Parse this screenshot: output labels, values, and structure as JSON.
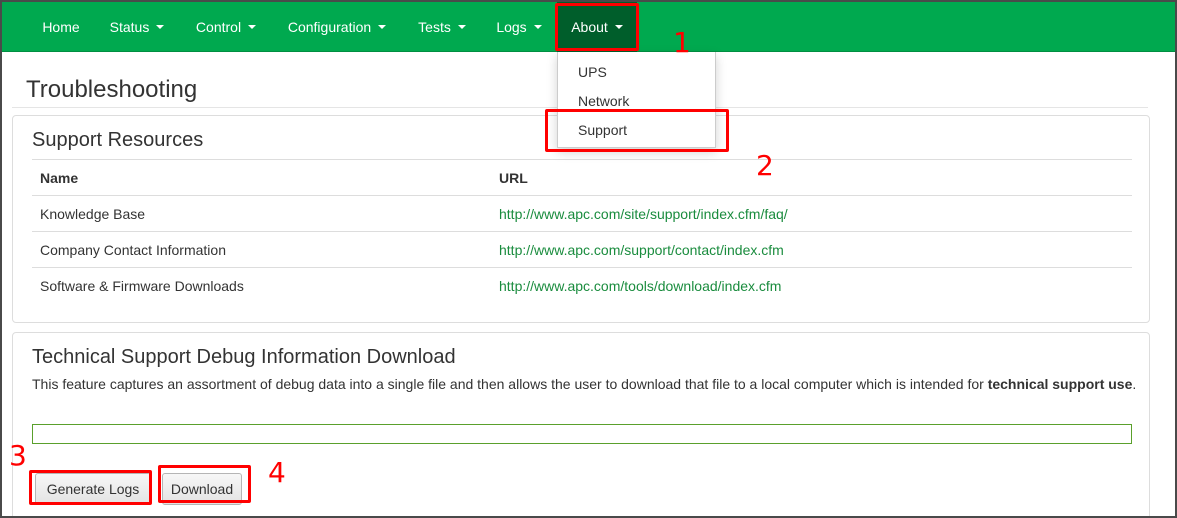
{
  "navbar": {
    "items": [
      {
        "label": "Home",
        "caret": false
      },
      {
        "label": "Status",
        "caret": true
      },
      {
        "label": "Control",
        "caret": true
      },
      {
        "label": "Configuration",
        "caret": true
      },
      {
        "label": "Tests",
        "caret": true
      },
      {
        "label": "Logs",
        "caret": true
      },
      {
        "label": "About",
        "caret": true,
        "active": true
      }
    ],
    "color": "#00a94f",
    "active_color": "#005e2b"
  },
  "dropdown": {
    "items": [
      "UPS",
      "Network",
      "Support"
    ]
  },
  "page": {
    "title": "Troubleshooting"
  },
  "resources": {
    "title": "Support Resources",
    "columns": [
      "Name",
      "URL"
    ],
    "rows": [
      {
        "name": "Knowledge Base",
        "url": "http://www.apc.com/site/support/index.cfm/faq/"
      },
      {
        "name": "Company Contact Information",
        "url": "http://www.apc.com/support/contact/index.cfm"
      },
      {
        "name": "Software & Firmware Downloads",
        "url": "http://www.apc.com/tools/download/index.cfm"
      }
    ],
    "link_color": "#1a8c3e"
  },
  "debug": {
    "title": "Technical Support Debug Information Download",
    "description_prefix": "This feature captures an assortment of debug data into a single file and then allows the user to download that file to a local computer which is intended for ",
    "description_bold": "technical support use",
    "description_suffix": ".",
    "progress_percent": 0,
    "generate_label": "Generate Logs",
    "download_label": "Download"
  },
  "annotations": {
    "color": "#ff0000",
    "numbers": [
      "1",
      "2",
      "3",
      "4"
    ]
  }
}
